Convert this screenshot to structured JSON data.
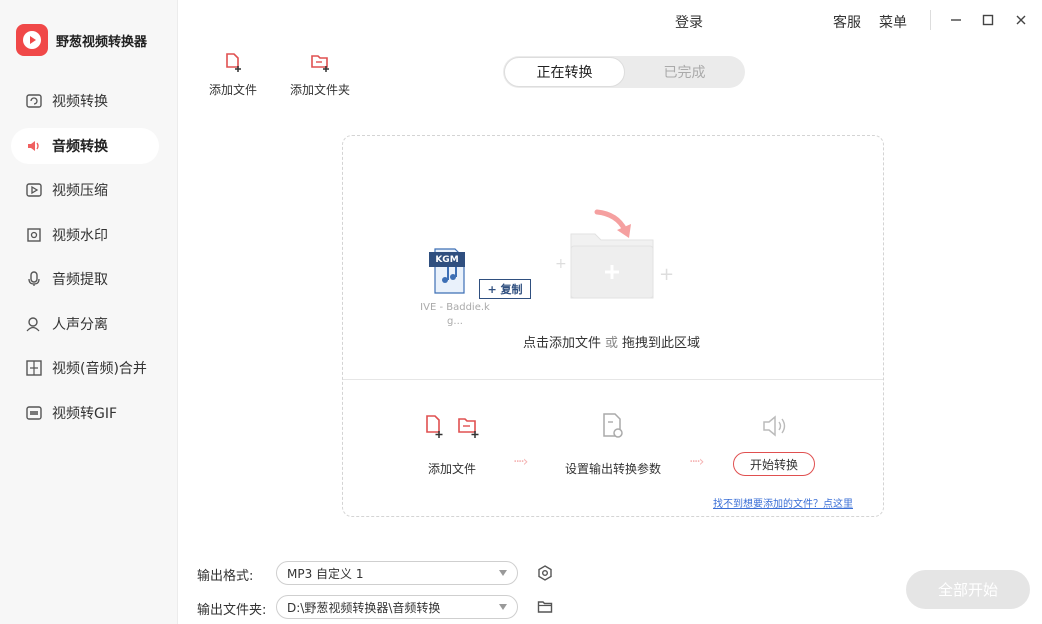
{
  "app": {
    "name": "野葱视频转换器"
  },
  "titlebar": {
    "login": "登录",
    "support": "客服",
    "menu": "菜单"
  },
  "sidebar": {
    "items": [
      {
        "label": "视频转换",
        "icon": "video-convert-icon",
        "active": false
      },
      {
        "label": "音频转换",
        "icon": "audio-convert-icon",
        "active": true
      },
      {
        "label": "视频压缩",
        "icon": "video-compress-icon",
        "active": false
      },
      {
        "label": "视频水印",
        "icon": "video-watermark-icon",
        "active": false
      },
      {
        "label": "音频提取",
        "icon": "audio-extract-icon",
        "active": false
      },
      {
        "label": "人声分离",
        "icon": "vocal-separate-icon",
        "active": false
      },
      {
        "label": "视频(音频)合并",
        "icon": "merge-icon",
        "active": false
      },
      {
        "label": "视频转GIF",
        "icon": "gif-icon",
        "active": false
      }
    ]
  },
  "toolbar": {
    "add_file": "添加文件",
    "add_folder": "添加文件夹"
  },
  "tabs": {
    "converting": "正在转换",
    "done": "已完成"
  },
  "dropzone": {
    "hint_add": "点击添加文件",
    "hint_or": "或",
    "hint_drag": "拖拽到此区域",
    "file_badge": "KGM",
    "drag_file_name": "IVE - Baddie.kg...",
    "copy_label": "+ 复制",
    "step1": "添加文件",
    "step2": "设置输出转换参数",
    "step3": "开始转换",
    "help_link": "找不到想要添加的文件？点这里"
  },
  "bottom": {
    "format_label": "输出格式:",
    "format_value": "MP3 自定义 1",
    "folder_label": "输出文件夹:",
    "folder_value": "D:\\野葱视频转换器\\音频转换",
    "start_all": "全部开始"
  },
  "colors": {
    "accent": "#f04848",
    "link": "#3b6fd6"
  }
}
